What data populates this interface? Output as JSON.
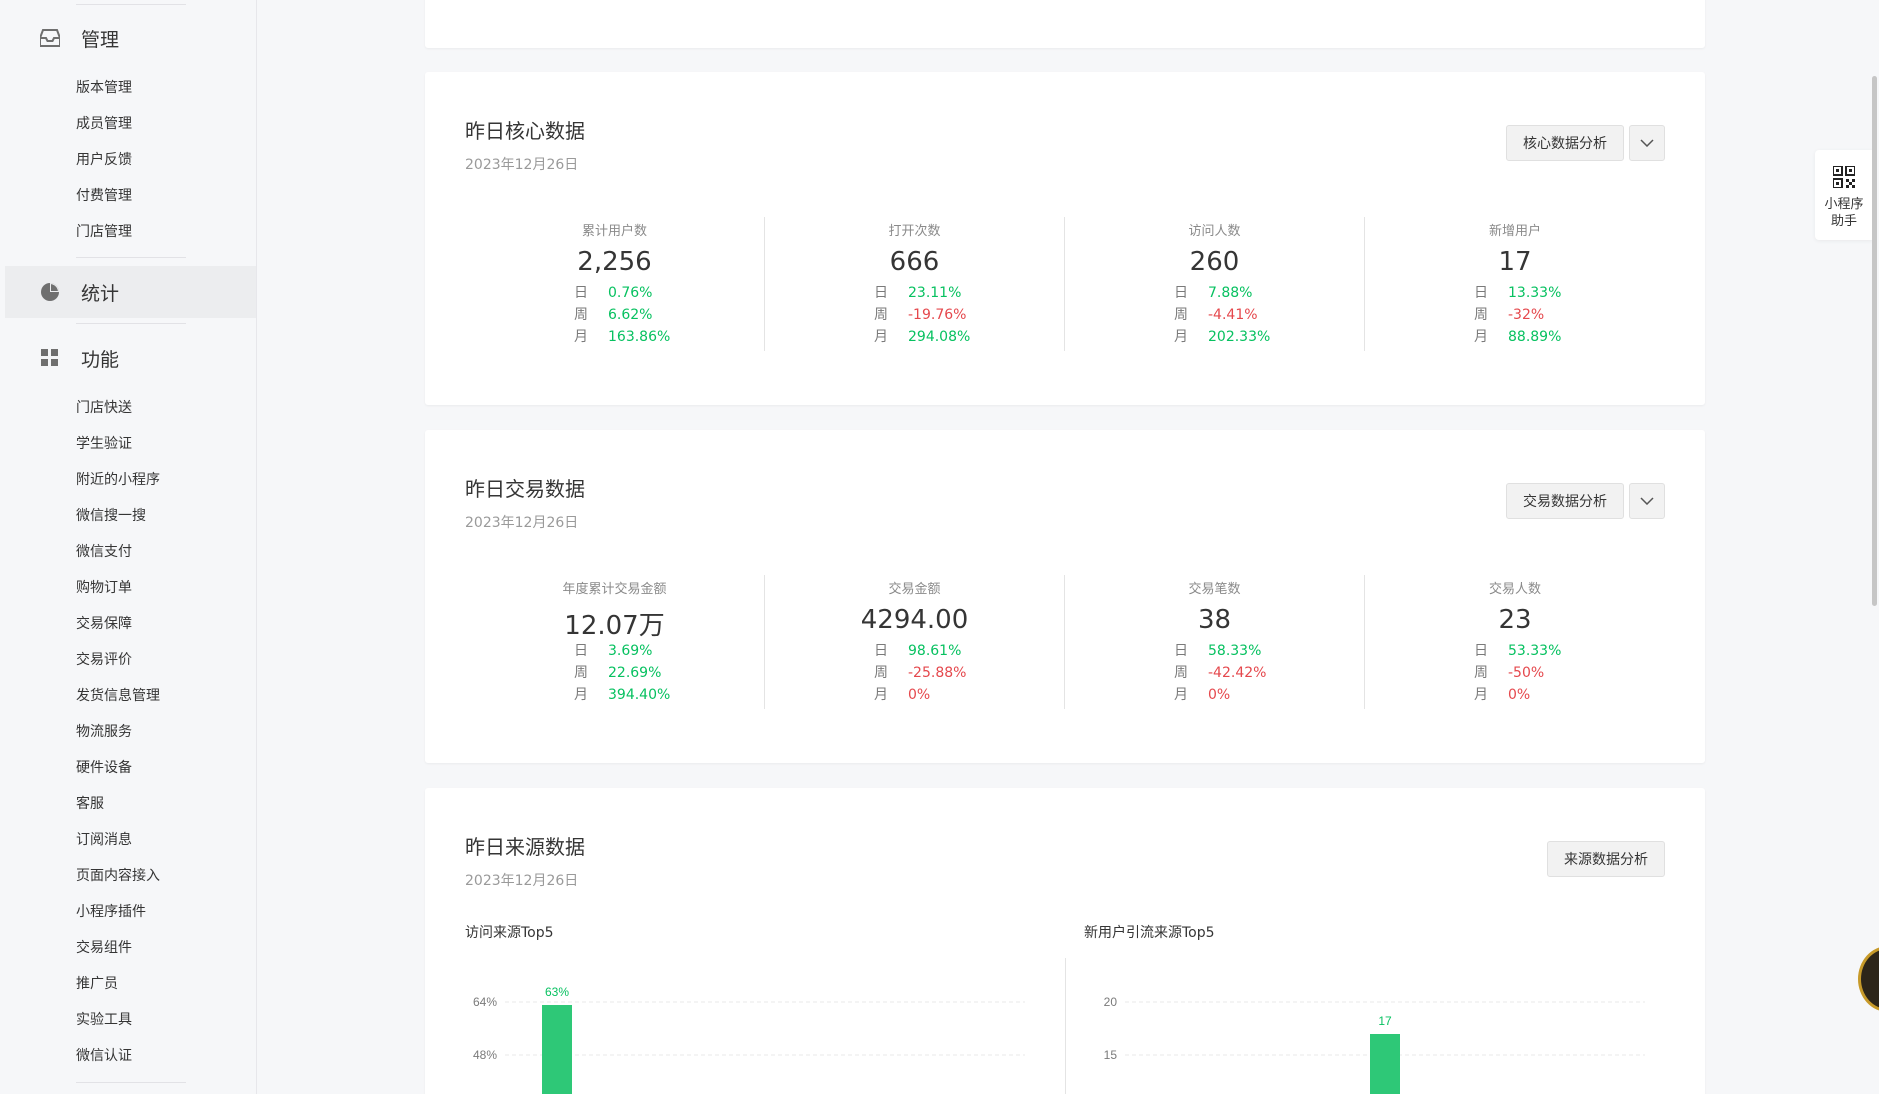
{
  "sidebar": {
    "groups": [
      {
        "label": "管理",
        "icon": "inbox-icon",
        "items": [
          "版本管理",
          "成员管理",
          "用户反馈",
          "付费管理",
          "门店管理"
        ]
      },
      {
        "label": "统计",
        "icon": "pie-chart-icon",
        "active": true,
        "items": []
      },
      {
        "label": "功能",
        "icon": "grid-icon",
        "items": [
          "门店快送",
          "学生验证",
          "附近的小程序",
          "微信搜一搜",
          "微信支付",
          "购物订单",
          "交易保障",
          "交易评价",
          "发货信息管理",
          "物流服务",
          "硬件设备",
          "客服",
          "订阅消息",
          "页面内容接入",
          "小程序插件",
          "交易组件",
          "推广员",
          "实验工具",
          "微信认证"
        ]
      }
    ]
  },
  "core": {
    "title": "昨日核心数据",
    "date": "2023年12月26日",
    "button": "核心数据分析",
    "metrics": [
      {
        "label": "累计用户数",
        "value": "2,256",
        "day": "0.76%",
        "week": "6.62%",
        "month": "163.86%"
      },
      {
        "label": "打开次数",
        "value": "666",
        "day": "23.11%",
        "week": "-19.76%",
        "month": "294.08%"
      },
      {
        "label": "访问人数",
        "value": "260",
        "day": "7.88%",
        "week": "-4.41%",
        "month": "202.33%"
      },
      {
        "label": "新增用户",
        "value": "17",
        "day": "13.33%",
        "week": "-32%",
        "month": "88.89%"
      }
    ]
  },
  "trade": {
    "title": "昨日交易数据",
    "date": "2023年12月26日",
    "button": "交易数据分析",
    "metrics": [
      {
        "label": "年度累计交易金额",
        "value": "12.07万",
        "day": "3.69%",
        "week": "22.69%",
        "month": "394.40%"
      },
      {
        "label": "交易金额",
        "value": "4294.00",
        "day": "98.61%",
        "week": "-25.88%",
        "month": "0%"
      },
      {
        "label": "交易笔数",
        "value": "38",
        "day": "58.33%",
        "week": "-42.42%",
        "month": "0%"
      },
      {
        "label": "交易人数",
        "value": "23",
        "day": "53.33%",
        "week": "-50%",
        "month": "0%"
      }
    ]
  },
  "row_keys": {
    "day": "日",
    "week": "周",
    "month": "月"
  },
  "source": {
    "title": "昨日来源数据",
    "date": "2023年12月26日",
    "button": "来源数据分析"
  },
  "chart_data": [
    {
      "type": "bar",
      "title": "访问来源Top5",
      "yticks": [
        "64%",
        "48%"
      ],
      "visible_values": [
        63
      ],
      "data_labels": [
        "63%"
      ],
      "color": "#2ec877"
    },
    {
      "type": "bar",
      "title": "新用户引流来源Top5",
      "yticks": [
        "20",
        "15"
      ],
      "visible_values": [
        17
      ],
      "data_labels": [
        "17"
      ],
      "color": "#2ec877"
    }
  ],
  "helper": {
    "icon": "qr-code-icon",
    "line1": "小程序",
    "line2": "助手"
  },
  "colors": {
    "up": "#07c160",
    "down": "#e5484d",
    "bar": "#2ec877"
  }
}
